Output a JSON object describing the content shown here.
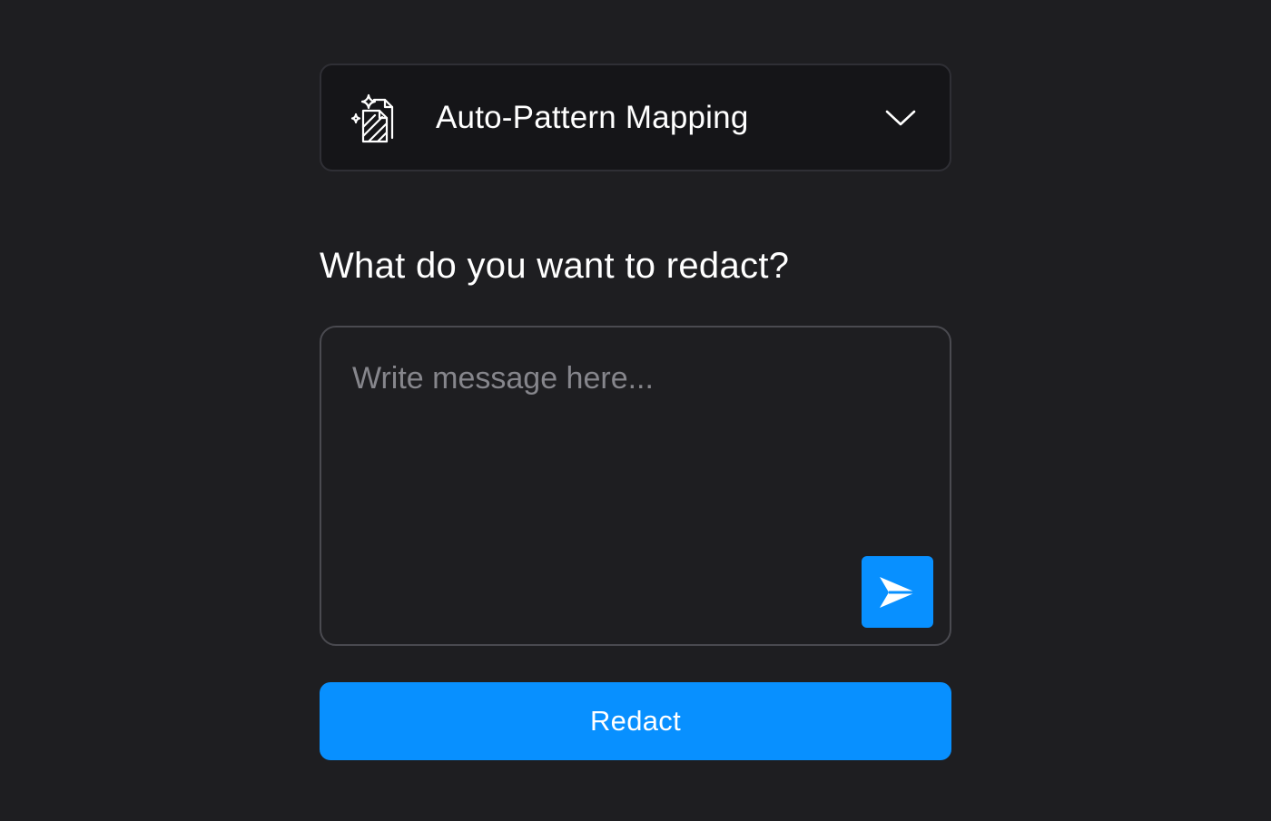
{
  "mode_selector": {
    "label": "Auto-Pattern Mapping",
    "icon": "sparkle-document-icon",
    "toggle_icon": "chevron-down-icon"
  },
  "prompt": {
    "question": "What do you want to redact?"
  },
  "message": {
    "value": "",
    "placeholder": "Write message here...",
    "send_icon": "send-icon"
  },
  "actions": {
    "redact_label": "Redact"
  },
  "colors": {
    "background": "#1e1e21",
    "selector_background": "#151518",
    "accent": "#0890ff",
    "placeholder": "#86868c"
  }
}
